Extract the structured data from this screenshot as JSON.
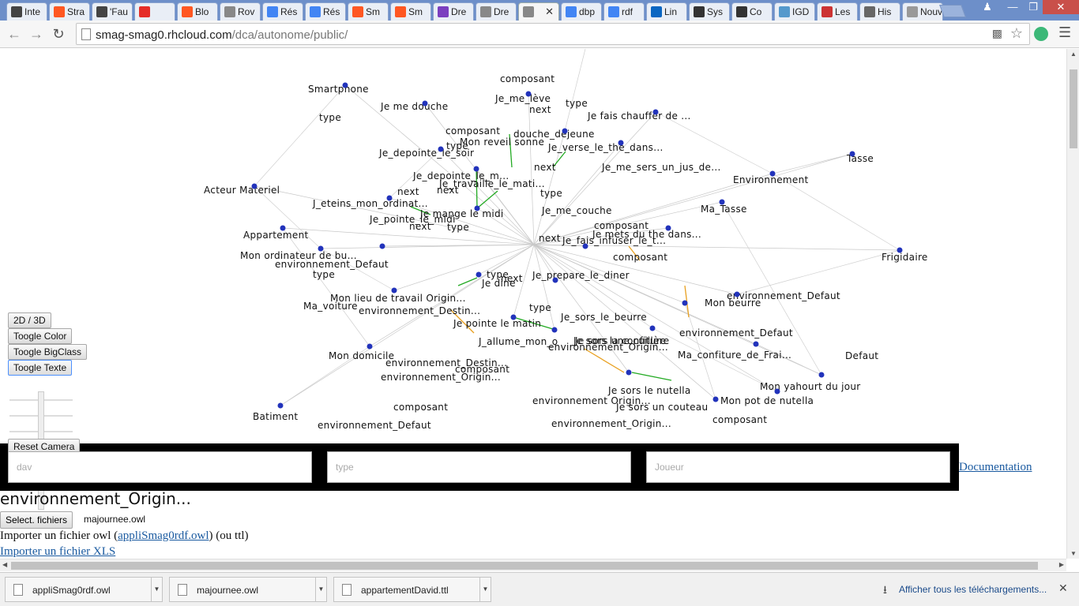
{
  "tabs": [
    {
      "label": "Inte",
      "icon": "library-icon",
      "color": "#444444"
    },
    {
      "label": "Stra",
      "icon": "blogger-icon",
      "color": "#ff5722"
    },
    {
      "label": "'Fau",
      "icon": "library-icon",
      "color": "#444444"
    },
    {
      "label": "",
      "icon": "youtube-icon",
      "color": "#e52d27"
    },
    {
      "label": "Blo",
      "icon": "blogger-icon",
      "color": "#ff5722"
    },
    {
      "label": "Rov",
      "icon": "page-icon",
      "color": "#888888"
    },
    {
      "label": "Rés",
      "icon": "google-icon",
      "color": "#4285f4"
    },
    {
      "label": "Rés",
      "icon": "google-icon",
      "color": "#4285f4"
    },
    {
      "label": "Sm",
      "icon": "blogger-icon",
      "color": "#ff5722"
    },
    {
      "label": "Sm",
      "icon": "blogger-icon",
      "color": "#ff5722"
    },
    {
      "label": "Dre",
      "icon": "onenote-icon",
      "color": "#7b3fbf"
    },
    {
      "label": "Dre",
      "icon": "page-icon",
      "color": "#888888"
    },
    {
      "label": "",
      "icon": "page-icon",
      "color": "#888888",
      "active": true
    },
    {
      "label": "dbp",
      "icon": "google-icon",
      "color": "#4285f4"
    },
    {
      "label": "rdf",
      "icon": "google-icon",
      "color": "#4285f4"
    },
    {
      "label": "Lin",
      "icon": "linkedin-icon",
      "color": "#0a66c2"
    },
    {
      "label": "Sys",
      "icon": "wikipedia-icon",
      "color": "#333333"
    },
    {
      "label": "Co",
      "icon": "wikipedia-icon",
      "color": "#333333"
    },
    {
      "label": "IGD",
      "icon": "igd-icon",
      "color": "#5599cc"
    },
    {
      "label": "Les",
      "icon": "site-icon",
      "color": "#cc3333"
    },
    {
      "label": "His",
      "icon": "history-icon",
      "color": "#666666"
    },
    {
      "label": "Nouve",
      "icon": "newtab-page-icon",
      "color": "#999999"
    }
  ],
  "browser": {
    "url_host": "smag-smag0.rhcloud.com",
    "url_path": "/dca/autonome/public/"
  },
  "controls": {
    "toggle_dim": "2D / 3D",
    "toggle_color": "Toogle Color",
    "toggle_bigclass": "Toogle BigClass",
    "toggle_text": "Toogle Texte",
    "reset_camera": "Reset Camera"
  },
  "search": {
    "subject_placeholder": "dav",
    "predicate_placeholder": "type",
    "object_placeholder": "Joueur",
    "documentation_link": "Documentation"
  },
  "selected_node": "environnement_Origin...",
  "file_input": {
    "button_label": "Select. fichiers",
    "file_name": "majournee.owl"
  },
  "import": {
    "owl_prefix": "Importer un fichier owl (",
    "owl_link": "appliSmag0rdf.owl",
    "owl_suffix": ") (ou ttl)",
    "xls_link": "Importer un fichier XLS"
  },
  "downloads": {
    "items": [
      "appliSmag0rdf.owl",
      "majournee.owl",
      "appartementDavid.ttl"
    ],
    "show_all": "Afficher tous les téléchargements..."
  },
  "graph_labels": [
    "composant",
    "Smartphone",
    "Je_me_lève",
    "type",
    "Je me douche",
    "next",
    "Je fais chauffer de ...",
    "type",
    "composant",
    "douche_dejeune",
    "Mon reveil sonne",
    "type",
    "Je_depointe_le_soir",
    "Je_verse_le_the_dans...",
    "Tasse",
    "next",
    "Je_me_sers_un_jus_de...",
    "Je_depointe_le_m...",
    "Je_travaille_le_mati...",
    "Environnement",
    "Acteur Materiel",
    "next",
    "next",
    "type",
    "Je_me_couche",
    "J_eteins_mon_ordinat...",
    "Je mange le midi",
    "Ma_Tasse",
    "Je_pointe_le_midi",
    "next",
    "type",
    "composant",
    "Appartement",
    "Je mets du the dans...",
    "next",
    "Je_fais_infuser_le_t...",
    "Frigidaire",
    "Mon ordinateur de bu...",
    "environnement_Defaut",
    "composant",
    "type",
    "Je_prepare_le_diner",
    "type",
    "Je dine",
    "next",
    "environnement_Defaut",
    "Mon lieu de travail Origin...",
    "Ma_voiture",
    "Mon beurre",
    "environnement_Destin...",
    "Je_sors_le_beurre",
    "type",
    "Je pointe le matin",
    "Je sors une cuillère",
    "environnement_Defaut",
    "J_allume_mon_o",
    "Je sors la confiture",
    "Ma_confiture_de_Frai...",
    "Mon domicile",
    "environnement_Origin...",
    "environnement_Destin...",
    "Defaut",
    "composant",
    "environnement_Origin...",
    "Je sors le nutella",
    "Mon yahourt du jour",
    "composant",
    "environnement Origin...",
    "Mon pot de nutella",
    "Je sors un couteau",
    "Batiment",
    "environnement_Defaut",
    "environnement_Origin...",
    "composant"
  ],
  "colors": {
    "tabstrip": "#6d8fc9",
    "link": "#1a5aa0",
    "node": "#2233bb",
    "edge_next": "#22aa22",
    "edge_comp": "#e8a020"
  }
}
